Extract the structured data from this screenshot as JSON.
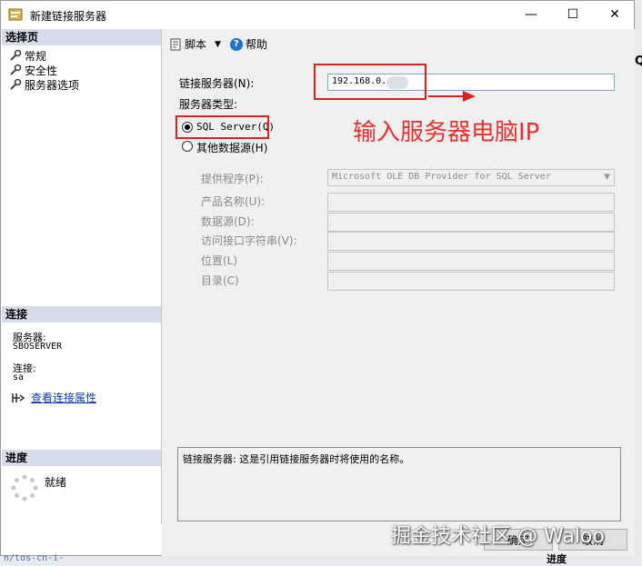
{
  "window": {
    "title": "新建链接服务器",
    "minimize": "—",
    "maximize": "☐",
    "close": "✕"
  },
  "left": {
    "select_page_header": "选择页",
    "pages": [
      {
        "label": "常规"
      },
      {
        "label": "安全性"
      },
      {
        "label": "服务器选项"
      }
    ],
    "connection_header": "连接",
    "server_label": "服务器:",
    "server_value": "SBOSERVER",
    "connection_label": "连接:",
    "connection_value": "sa",
    "view_props_link": "查看连接属性",
    "progress_header": "进度",
    "progress_status": "就绪"
  },
  "toolbar": {
    "script_label": "脚本",
    "help_label": "帮助",
    "help_glyph": "?"
  },
  "form": {
    "linked_server_label": "链接服务器(N):",
    "linked_server_value": "192.168.0.",
    "server_type_label": "服务器类型:",
    "sql_server_label": "SQL Server(Q)",
    "other_source_label": "其他数据源(H)",
    "provider_label": "提供程序(P):",
    "provider_value": "Microsoft OLE DB Provider for SQL Server",
    "product_label": "产品名称(U):",
    "datasource_label": "数据源(D):",
    "connstr_label": "访问接口字符串(V):",
    "location_label": "位置(L)",
    "catalog_label": "目录(C)",
    "selected_type": "sql_server"
  },
  "annotation": {
    "text": "输入服务器电脑IP",
    "color": "#e83030"
  },
  "description": "链接服务器: 这是引用链接服务器时将使用的名称。",
  "footer": {
    "ok_label": "确定",
    "cancel_label": "取消"
  },
  "watermark": "掘金技术社区 @ Waloo",
  "background": {
    "url_fragment": "n/tos-cn-i-",
    "progress": "进度",
    "q": "Q"
  }
}
